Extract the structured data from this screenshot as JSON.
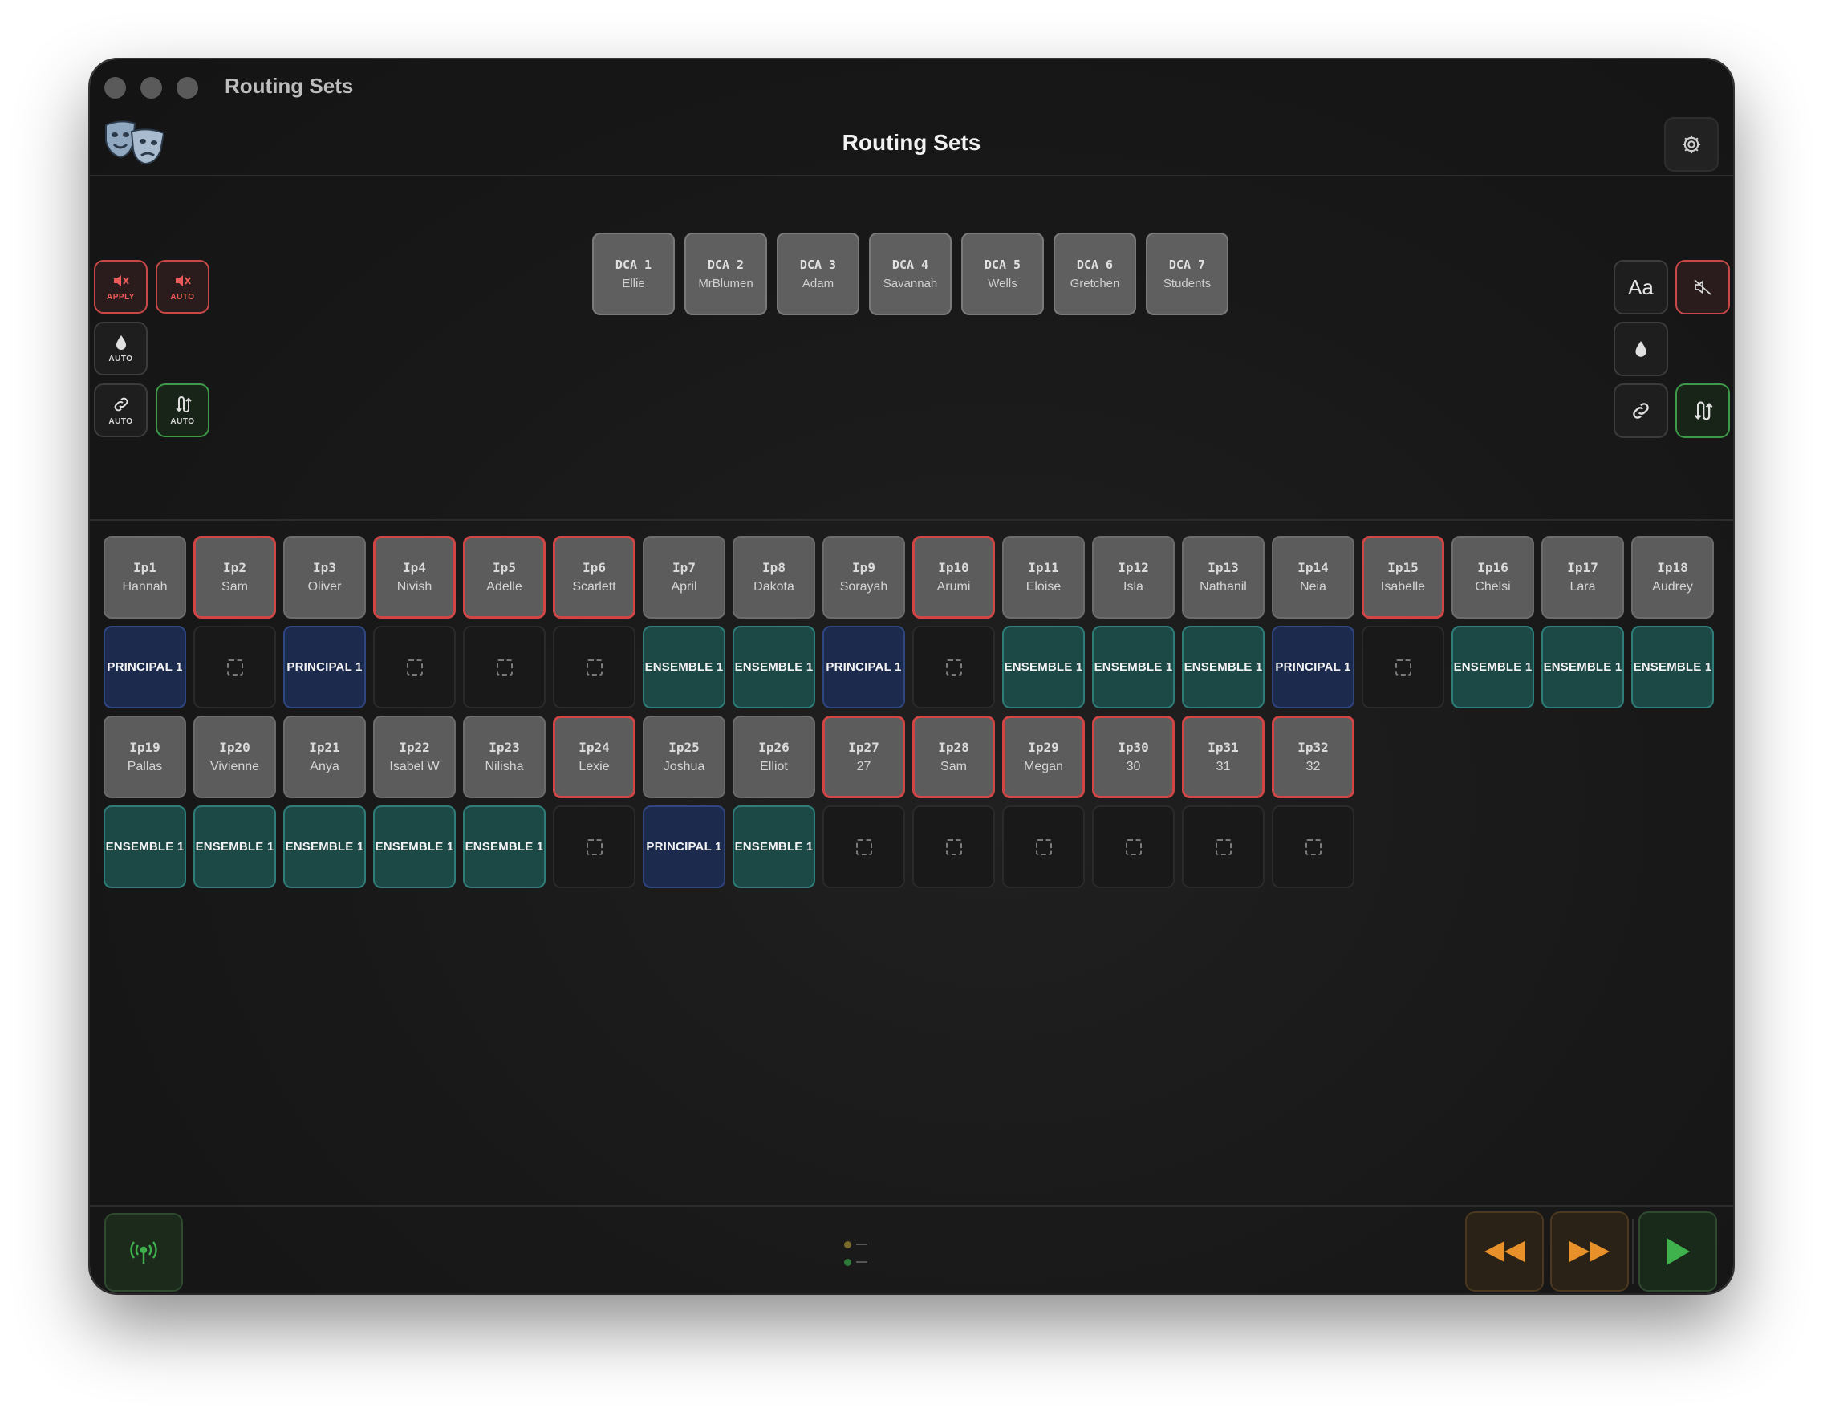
{
  "window": {
    "title": "Routing Sets"
  },
  "header": {
    "title": "Routing Sets"
  },
  "dcas": [
    {
      "id": "DCA 1",
      "name": "Ellie"
    },
    {
      "id": "DCA 2",
      "name": "MrBlumen"
    },
    {
      "id": "DCA 3",
      "name": "Adam"
    },
    {
      "id": "DCA 4",
      "name": "Savannah"
    },
    {
      "id": "DCA 5",
      "name": "Wells"
    },
    {
      "id": "DCA 6",
      "name": "Gretchen"
    },
    {
      "id": "DCA 7",
      "name": "Students"
    }
  ],
  "left_controls": {
    "mute_apply": "APPLY",
    "mute_auto": "AUTO",
    "drop_auto": "AUTO",
    "link_auto": "AUTO",
    "route_auto": "AUTO"
  },
  "right_controls": {
    "font_label": "Aa"
  },
  "inputs_row1": [
    {
      "id": "Ip1",
      "name": "Hannah",
      "muted": false,
      "set": "PRINCIPAL 1",
      "type": "principal"
    },
    {
      "id": "Ip2",
      "name": "Sam",
      "muted": true,
      "set": "",
      "type": "empty"
    },
    {
      "id": "Ip3",
      "name": "Oliver",
      "muted": false,
      "set": "PRINCIPAL 1",
      "type": "principal"
    },
    {
      "id": "Ip4",
      "name": "Nivish",
      "muted": true,
      "set": "",
      "type": "empty"
    },
    {
      "id": "Ip5",
      "name": "Adelle",
      "muted": true,
      "set": "",
      "type": "empty"
    },
    {
      "id": "Ip6",
      "name": "Scarlett",
      "muted": true,
      "set": "",
      "type": "empty"
    },
    {
      "id": "Ip7",
      "name": "April",
      "muted": false,
      "set": "ENSEMBLE 1",
      "type": "ensemble"
    },
    {
      "id": "Ip8",
      "name": "Dakota",
      "muted": false,
      "set": "ENSEMBLE 1",
      "type": "ensemble"
    },
    {
      "id": "Ip9",
      "name": "Sorayah",
      "muted": false,
      "set": "PRINCIPAL 1",
      "type": "principal"
    },
    {
      "id": "Ip10",
      "name": "Arumi",
      "muted": true,
      "set": "",
      "type": "empty"
    },
    {
      "id": "Ip11",
      "name": "Eloise",
      "muted": false,
      "set": "ENSEMBLE 1",
      "type": "ensemble"
    },
    {
      "id": "Ip12",
      "name": "Isla",
      "muted": false,
      "set": "ENSEMBLE 1",
      "type": "ensemble"
    },
    {
      "id": "Ip13",
      "name": "Nathanil",
      "muted": false,
      "set": "ENSEMBLE 1",
      "type": "ensemble"
    },
    {
      "id": "Ip14",
      "name": "Neia",
      "muted": false,
      "set": "PRINCIPAL 1",
      "type": "principal"
    },
    {
      "id": "Ip15",
      "name": "Isabelle",
      "muted": true,
      "set": "",
      "type": "empty"
    },
    {
      "id": "Ip16",
      "name": "Chelsi",
      "muted": false,
      "set": "ENSEMBLE 1",
      "type": "ensemble"
    },
    {
      "id": "Ip17",
      "name": "Lara",
      "muted": false,
      "set": "ENSEMBLE 1",
      "type": "ensemble"
    },
    {
      "id": "Ip18",
      "name": "Audrey",
      "muted": false,
      "set": "ENSEMBLE 1",
      "type": "ensemble"
    }
  ],
  "inputs_row2": [
    {
      "id": "Ip19",
      "name": "Pallas",
      "muted": false,
      "set": "ENSEMBLE 1",
      "type": "ensemble"
    },
    {
      "id": "Ip20",
      "name": "Vivienne",
      "muted": false,
      "set": "ENSEMBLE 1",
      "type": "ensemble"
    },
    {
      "id": "Ip21",
      "name": "Anya",
      "muted": false,
      "set": "ENSEMBLE 1",
      "type": "ensemble"
    },
    {
      "id": "Ip22",
      "name": "Isabel W",
      "muted": false,
      "set": "ENSEMBLE 1",
      "type": "ensemble"
    },
    {
      "id": "Ip23",
      "name": "Nilisha",
      "muted": false,
      "set": "ENSEMBLE 1",
      "type": "ensemble"
    },
    {
      "id": "Ip24",
      "name": "Lexie",
      "muted": true,
      "set": "",
      "type": "empty"
    },
    {
      "id": "Ip25",
      "name": "Joshua",
      "muted": false,
      "set": "PRINCIPAL 1",
      "type": "principal"
    },
    {
      "id": "Ip26",
      "name": "Elliot",
      "muted": false,
      "set": "ENSEMBLE 1",
      "type": "ensemble"
    },
    {
      "id": "Ip27",
      "name": "27",
      "muted": true,
      "set": "",
      "type": "empty"
    },
    {
      "id": "Ip28",
      "name": "Sam",
      "muted": true,
      "set": "",
      "type": "empty"
    },
    {
      "id": "Ip29",
      "name": "Megan",
      "muted": true,
      "set": "",
      "type": "empty"
    },
    {
      "id": "Ip30",
      "name": "30",
      "muted": true,
      "set": "",
      "type": "empty"
    },
    {
      "id": "Ip31",
      "name": "31",
      "muted": true,
      "set": "",
      "type": "empty"
    },
    {
      "id": "Ip32",
      "name": "32",
      "muted": true,
      "set": "",
      "type": "empty"
    }
  ],
  "colors": {
    "muted_border": "#d04545",
    "principal": "#1c2a4e",
    "ensemble": "#1c4846",
    "transport_orange": "#e8902a",
    "play_green": "#3fb24e"
  },
  "icons": {
    "logo": "theatre-masks-icon",
    "settings": "gear-icon",
    "mute": "speaker-mute-icon",
    "drop": "droplet-icon",
    "link": "link-icon",
    "route": "route-arrows-icon",
    "network": "antenna-icon",
    "rewind": "rewind-icon",
    "fast_forward": "fast-forward-icon",
    "play": "play-icon"
  }
}
